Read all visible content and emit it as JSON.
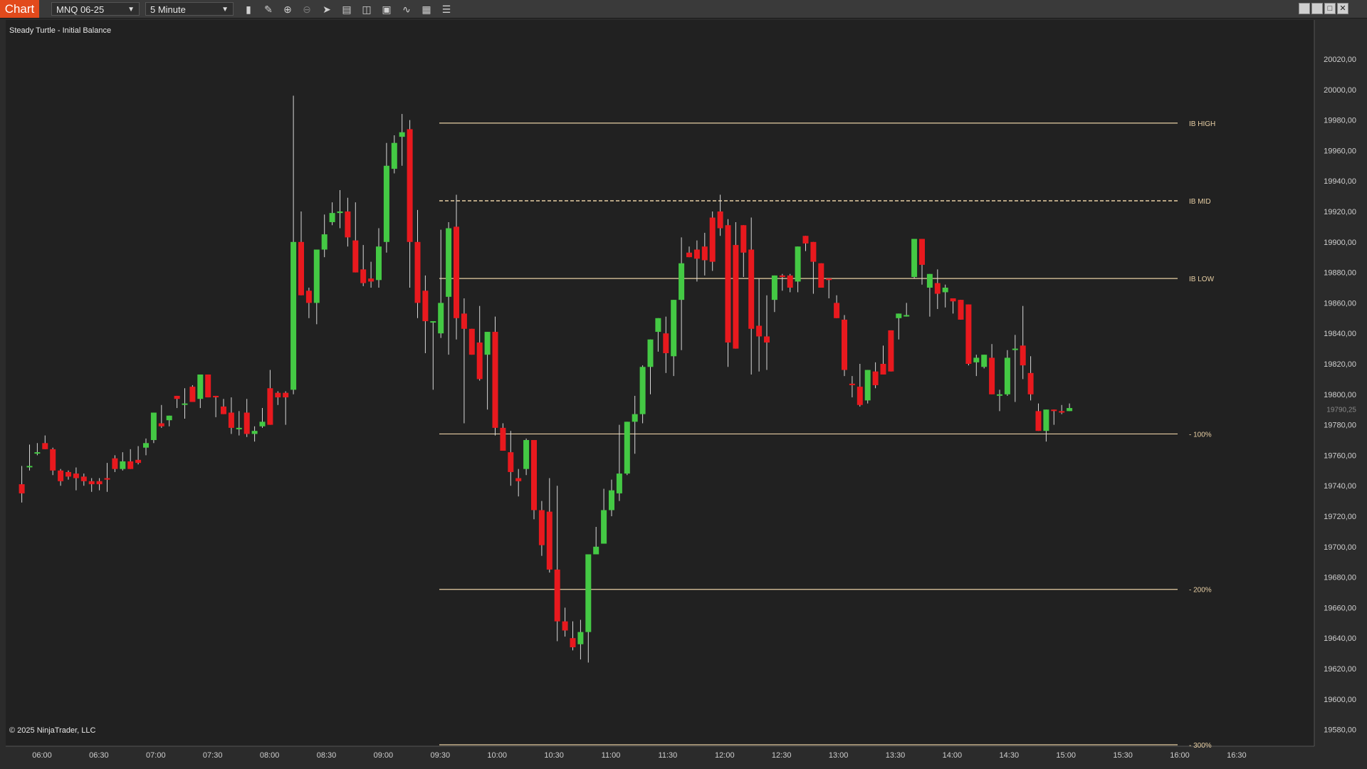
{
  "toolbar": {
    "tab_label": "Chart",
    "instrument": "MNQ 06-25",
    "interval": "5 Minute",
    "icons": [
      "bar-type-icon",
      "draw-tool-icon",
      "zoom-in-icon",
      "zoom-out-icon",
      "pointer-icon",
      "data-box-icon",
      "template-icon",
      "properties-icon",
      "strategy-icon",
      "indicators-icon",
      "list-icon"
    ],
    "window_buttons": [
      "tile-icon",
      "restore-icon",
      "maximize-icon",
      "close-icon"
    ]
  },
  "chart": {
    "title": "Steady Turtle - Initial Balance",
    "copyright": "© 2025 NinjaTrader, LLC",
    "current_price_label": "19790,25",
    "colors": {
      "up": "#44c944",
      "down": "#e8191e",
      "level_line": "#e8cfa4",
      "wick": "#d8d8d8",
      "background": "#212121"
    }
  },
  "chart_data": {
    "type": "candlestick",
    "y_ticks": [
      "20020,00",
      "20000,00",
      "19980,00",
      "19960,00",
      "19940,00",
      "19920,00",
      "19900,00",
      "19880,00",
      "19860,00",
      "19840,00",
      "19820,00",
      "19800,00",
      "19780,00",
      "19760,00",
      "19740,00",
      "19720,00",
      "19700,00",
      "19680,00",
      "19660,00",
      "19640,00",
      "19620,00",
      "19600,00",
      "19580,00"
    ],
    "x_ticks": [
      "06:00",
      "06:30",
      "07:00",
      "07:30",
      "08:00",
      "08:30",
      "09:00",
      "09:30",
      "10:00",
      "10:30",
      "11:00",
      "11:30",
      "12:00",
      "12:30",
      "13:00",
      "13:30",
      "14:00",
      "14:30",
      "15:00",
      "15:30",
      "16:00",
      "16:30"
    ],
    "ylim": [
      19570,
      20030
    ],
    "levels": [
      {
        "label": "IB HIGH",
        "price": 19978,
        "style": "solid"
      },
      {
        "label": "IB MID",
        "price": 19927,
        "style": "dashed"
      },
      {
        "label": "IB LOW",
        "price": 19876,
        "style": "solid"
      },
      {
        "label": "- 100%",
        "price": 19774,
        "style": "solid"
      },
      {
        "label": "- 200%",
        "price": 19672,
        "style": "solid"
      },
      {
        "label": "- 300%",
        "price": 19570,
        "style": "solid"
      }
    ],
    "candles": [
      [
        19741,
        19753,
        19735,
        19729
      ],
      [
        19753,
        19767,
        19753,
        19750
      ],
      [
        19762,
        19768,
        19762,
        19760
      ],
      [
        19768,
        19769,
        19764,
        19773
      ],
      [
        19764,
        19765,
        19750,
        19747
      ],
      [
        19750,
        19751,
        19743,
        19740
      ],
      [
        19749,
        19750,
        19746,
        19744
      ],
      [
        19748,
        19752,
        19745,
        19737
      ],
      [
        19746,
        19748,
        19743,
        19740
      ],
      [
        19743,
        19745,
        19741,
        19736
      ],
      [
        19743,
        19745,
        19741,
        19737
      ],
      [
        19745,
        19755,
        19744,
        19736
      ],
      [
        19758,
        19760,
        19751,
        19749
      ],
      [
        19751,
        19762,
        19756,
        19750
      ],
      [
        19756,
        19764,
        19751,
        19753
      ],
      [
        19757,
        19766,
        19755,
        19754
      ],
      [
        19765,
        19771,
        19768,
        19760
      ],
      [
        19770,
        19777,
        19788,
        19768
      ],
      [
        19781,
        19793,
        19779,
        19778
      ],
      [
        19783,
        19781,
        19786,
        19779
      ],
      [
        19799,
        19791,
        19797,
        19796
      ],
      [
        19794,
        19804,
        19794,
        19784
      ],
      [
        19805,
        19806,
        19795,
        19795
      ],
      [
        19797,
        19813,
        19813,
        19791
      ],
      [
        19813,
        19813,
        19798,
        19800
      ],
      [
        19799,
        19796,
        19798,
        19785
      ],
      [
        19792,
        19797,
        19787,
        19788
      ],
      [
        19788,
        19798,
        19778,
        19774
      ],
      [
        19778,
        19789,
        19778,
        19773
      ],
      [
        19788,
        19797,
        19774,
        19772
      ],
      [
        19774,
        19779,
        19776,
        19769
      ],
      [
        19779,
        19791,
        19782,
        19778
      ],
      [
        19804,
        19816,
        19780,
        19782
      ],
      [
        19801,
        19802,
        19798,
        19793
      ],
      [
        19801,
        19802,
        19798,
        19780
      ],
      [
        19803,
        19996,
        19900,
        19800
      ],
      [
        19900,
        19920,
        19865,
        19865
      ],
      [
        19868,
        19870,
        19860,
        19850
      ],
      [
        19860,
        19864,
        19895,
        19846
      ],
      [
        19895,
        19918,
        19905,
        19890
      ],
      [
        19913,
        19926,
        19919,
        19911
      ],
      [
        19919,
        19934,
        19920,
        19909
      ],
      [
        19920,
        19929,
        19903,
        19897
      ],
      [
        19901,
        19926,
        19880,
        19880
      ],
      [
        19882,
        19898,
        19873,
        19871
      ],
      [
        19876,
        19887,
        19874,
        19870
      ],
      [
        19875,
        19909,
        19897,
        19870
      ],
      [
        19900,
        19965,
        19950,
        19893
      ],
      [
        19948,
        19970,
        19965,
        19945
      ],
      [
        19969,
        19984,
        19972,
        19950
      ],
      [
        19974,
        19980,
        19900,
        19870
      ],
      [
        19900,
        19921,
        19860,
        19850
      ],
      [
        19868,
        19878,
        19848,
        19827
      ],
      [
        19848,
        19848,
        19848,
        19803
      ],
      [
        19840,
        19908,
        19860,
        19837
      ],
      [
        19864,
        19913,
        19909,
        19826
      ],
      [
        19910,
        19931,
        19850,
        19836
      ],
      [
        19853,
        19863,
        19843,
        19781
      ],
      [
        19843,
        19831,
        19826,
        19831
      ],
      [
        19834,
        19858,
        19810,
        19809
      ],
      [
        19826,
        19841,
        19841,
        19790
      ],
      [
        19841,
        19851,
        19778,
        19773
      ],
      [
        19778,
        19781,
        19763,
        19772
      ],
      [
        19762,
        19776,
        19749,
        19740
      ],
      [
        19745,
        19751,
        19743,
        19733
      ],
      [
        19751,
        19771,
        19770,
        19747
      ],
      [
        19770,
        19770,
        19724,
        19718
      ],
      [
        19724,
        19730,
        19701,
        19694
      ],
      [
        19723,
        19745,
        19685,
        19683
      ],
      [
        19685,
        19740,
        19651,
        19638
      ],
      [
        19651,
        19660,
        19645,
        19641
      ],
      [
        19640,
        19651,
        19634,
        19632
      ],
      [
        19636,
        19652,
        19644,
        19626
      ],
      [
        19644,
        19670,
        19695,
        19624
      ],
      [
        19695,
        19713,
        19700,
        19695
      ],
      [
        19702,
        19738,
        19724,
        19702
      ],
      [
        19724,
        19744,
        19737,
        19720
      ],
      [
        19735,
        19780,
        19748,
        19730
      ],
      [
        19748,
        19782,
        19782,
        19747
      ],
      [
        19782,
        19799,
        19787,
        19761
      ],
      [
        19787,
        19819,
        19818,
        19781
      ],
      [
        19818,
        19834,
        19836,
        19800
      ],
      [
        19841,
        19845,
        19850,
        19828
      ],
      [
        19840,
        19851,
        19827,
        19814
      ],
      [
        19825,
        19858,
        19862,
        19812
      ],
      [
        19862,
        19903,
        19886,
        19829
      ],
      [
        19893,
        19893,
        19890,
        19897
      ],
      [
        19895,
        19901,
        19889,
        19874
      ],
      [
        19897,
        19906,
        19888,
        19878
      ],
      [
        19916,
        19920,
        19887,
        19881
      ],
      [
        19920,
        19931,
        19909,
        19904
      ],
      [
        19911,
        19915,
        19834,
        19818
      ],
      [
        19898,
        19913,
        19830,
        19833
      ],
      [
        19911,
        19905,
        19893,
        19877
      ],
      [
        19895,
        19916,
        19843,
        19813
      ],
      [
        19845,
        19876,
        19838,
        19815
      ],
      [
        19838,
        19865,
        19834,
        19816
      ],
      [
        19862,
        19874,
        19878,
        19854
      ],
      [
        19878,
        19879,
        19877,
        19868
      ],
      [
        19878,
        19879,
        19870,
        19867
      ],
      [
        19874,
        19895,
        19897,
        19867
      ],
      [
        19904,
        19898,
        19899,
        19894
      ],
      [
        19900,
        19897,
        19887,
        19866
      ],
      [
        19886,
        19883,
        19870,
        19870
      ],
      [
        19876,
        19872,
        19875,
        19863
      ],
      [
        19860,
        19865,
        19850,
        19850
      ],
      [
        19849,
        19852,
        19816,
        19812
      ],
      [
        19807,
        19812,
        19806,
        19798
      ],
      [
        19805,
        19820,
        19793,
        19792
      ],
      [
        19796,
        19806,
        19816,
        19794
      ],
      [
        19815,
        19821,
        19806,
        19804
      ],
      [
        19820,
        19832,
        19813,
        19816
      ],
      [
        19842,
        19834,
        19815,
        19819
      ],
      [
        19850,
        19836,
        19853,
        19837
      ],
      [
        19852,
        19860,
        19852,
        19851
      ],
      [
        19877,
        19881,
        19902,
        19876
      ],
      [
        19902,
        19901,
        19885,
        19872
      ],
      [
        19870,
        19873,
        19879,
        19851
      ],
      [
        19873,
        19882,
        19866,
        19856
      ],
      [
        19867,
        19872,
        19870,
        19857
      ],
      [
        19863,
        19859,
        19861,
        19853
      ],
      [
        19862,
        19857,
        19849,
        19853
      ],
      [
        19859,
        19859,
        19820,
        19819
      ],
      [
        19821,
        19826,
        19824,
        19812
      ],
      [
        19818,
        19826,
        19826,
        19817
      ],
      [
        19824,
        19833,
        19800,
        19800
      ],
      [
        19800,
        19803,
        19800,
        19789
      ],
      [
        19800,
        19829,
        19824,
        19799
      ],
      [
        19830,
        19839,
        19830,
        19795
      ],
      [
        19832,
        19858,
        19819,
        19810
      ],
      [
        19814,
        19825,
        19800,
        19796
      ],
      [
        19789,
        19794,
        19776,
        19776
      ],
      [
        19776,
        19781,
        19790,
        19769
      ],
      [
        19790,
        19780,
        19789,
        19786
      ],
      [
        19789,
        19793,
        19788,
        19787
      ],
      [
        19789,
        19794,
        19791,
        19789
      ]
    ]
  }
}
